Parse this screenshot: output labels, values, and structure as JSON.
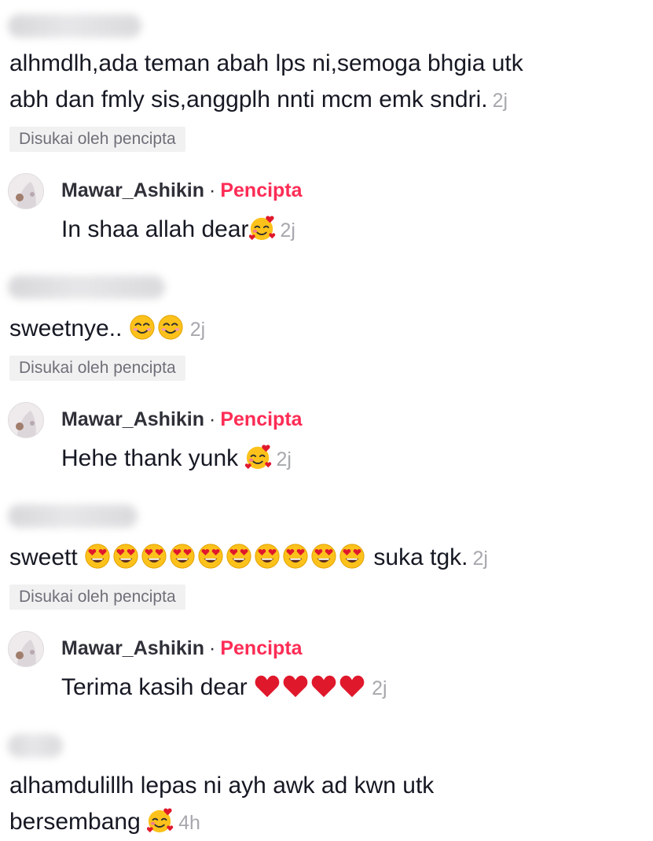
{
  "comments": [
    {
      "text_line1": "alhmdlh,ada teman abah lps ni,semoga bhgia utk",
      "text_line2": "abh dan fmly sis,anggplh nnti mcm emk sndri.",
      "time": "2j",
      "liked_by_creator": "Disukai oleh pencipta"
    },
    {
      "text": "sweetnye..",
      "time": "2j",
      "liked_by_creator": "Disukai oleh pencipta"
    },
    {
      "text_before": "sweett",
      "text_after": "suka tgk.",
      "time": "2j",
      "liked_by_creator": "Disukai oleh pencipta"
    },
    {
      "text_line1": "alhamdulillh lepas ni ayh awk ad kwn utk",
      "text_line2": "bersembang",
      "time": "4h"
    }
  ],
  "replies": [
    {
      "username": "Mawar_Ashikin",
      "separator": "·",
      "role": "Pencipta",
      "text": "In shaa allah dear",
      "time": "2j"
    },
    {
      "username": "Mawar_Ashikin",
      "separator": "·",
      "role": "Pencipta",
      "text": "Hehe thank yunk",
      "time": "2j"
    },
    {
      "username": "Mawar_Ashikin",
      "separator": "·",
      "role": "Pencipta",
      "text": "Terima kasih dear",
      "time": "2j"
    }
  ],
  "colors": {
    "creator_label": "#fe2c55",
    "timestamp": "#a7a8ad",
    "badge_bg": "#f1f1f2",
    "heart": "#e0182c"
  },
  "icons": {
    "smiling_hearts": "smiling-face-with-hearts-icon",
    "smiling_eyes": "smiling-face-with-smiling-eyes-icon",
    "heart_eyes": "smiling-face-with-heart-eyes-icon",
    "red_heart": "red-heart-icon"
  }
}
